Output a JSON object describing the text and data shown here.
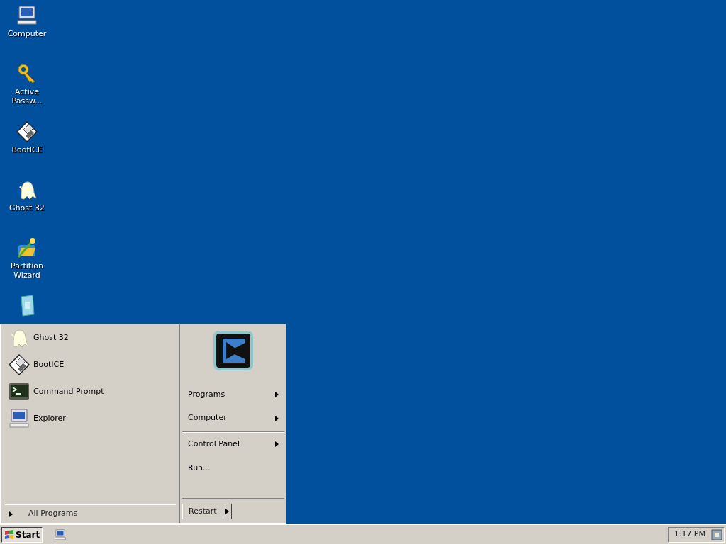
{
  "desktop_icons": [
    {
      "label": "Computer",
      "kind": "computer"
    },
    {
      "label": "Active Passw...",
      "kind": "key"
    },
    {
      "label": "BootICE",
      "kind": "disk"
    },
    {
      "label": "Ghost 32",
      "kind": "ghost"
    },
    {
      "label": "Partition Wizard",
      "kind": "wizard"
    },
    {
      "kind": "document"
    }
  ],
  "start_menu": {
    "pinned": [
      {
        "label": "Ghost 32",
        "kind": "ghost"
      },
      {
        "label": "BootICE",
        "kind": "disk"
      },
      {
        "label": "Command Prompt",
        "kind": "console"
      },
      {
        "label": "Explorer",
        "kind": "computer"
      }
    ],
    "all_programs": "All Programs",
    "right_items": [
      {
        "label": "Programs",
        "submenu": true,
        "separator_after": false
      },
      {
        "label": "Computer",
        "submenu": true,
        "separator_after": true
      },
      {
        "label": "Control Panel",
        "submenu": true,
        "separator_after": false
      },
      {
        "label": "Run...",
        "submenu": false,
        "separator_after": false
      }
    ],
    "restart": "Restart"
  },
  "taskbar": {
    "start": "Start",
    "pressed": true,
    "clock": "1:17 PM"
  }
}
